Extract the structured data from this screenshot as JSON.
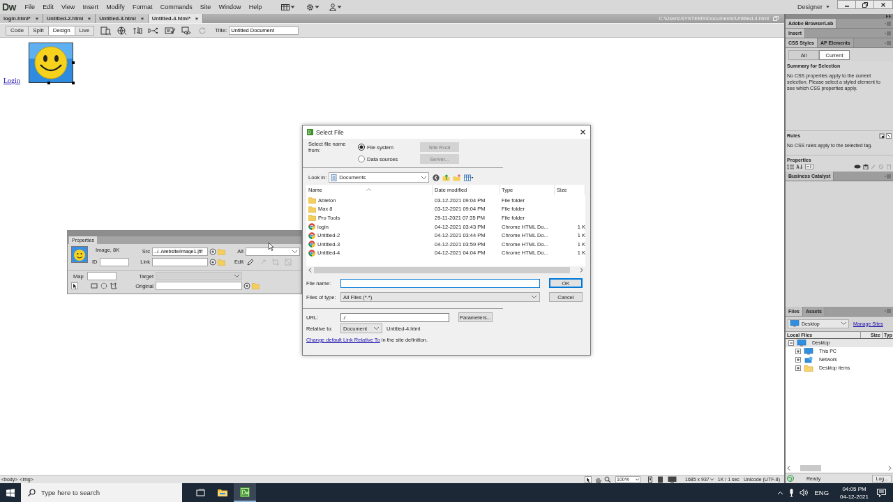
{
  "app": {
    "logo": "Dw",
    "menu": [
      "File",
      "Edit",
      "View",
      "Insert",
      "Modify",
      "Format",
      "Commands",
      "Site",
      "Window",
      "Help"
    ],
    "workspace": "Designer"
  },
  "doc_tabs": [
    {
      "label": "login.html*",
      "selected": false
    },
    {
      "label": "Untitled-2.html",
      "selected": false
    },
    {
      "label": "Untitled-3.html",
      "selected": false
    },
    {
      "label": "Untitled-4.html*",
      "selected": true
    }
  ],
  "file_path": "C:\\Users\\SYSTEMS\\Documents\\Untitled-4.html",
  "view_buttons": [
    {
      "label": "Code",
      "selected": false
    },
    {
      "label": "Split",
      "selected": false
    },
    {
      "label": "Design",
      "selected": true
    },
    {
      "label": "Live",
      "selected": false
    }
  ],
  "title_field": {
    "label": "Title:",
    "value": "Untitled Document"
  },
  "document": {
    "link": "Login"
  },
  "status_bar": {
    "tags": [
      "<body>",
      "<img>"
    ],
    "zoom": "100%",
    "dimensions": "1685 x 937",
    "download": "1K / 1 sec",
    "encoding": "Unicode (UTF-8)"
  },
  "properties": {
    "title": "Properties",
    "summary": "Image, 8K",
    "id_label": "ID",
    "src_label": "Src",
    "src": "../../website/image1.jfif",
    "alt_label": "Alt",
    "link_label": "Link",
    "edit_label": "Edit",
    "map_label": "Map",
    "target_label": "Target",
    "original_label": "Original"
  },
  "dialog": {
    "title": "Select File",
    "source_label": "Select file name from:",
    "sources": [
      {
        "label": "File system",
        "selected": true
      },
      {
        "label": "Data sources",
        "selected": false
      }
    ],
    "site_root": "Site Root",
    "server": "Server...",
    "look_in_label": "Look in:",
    "look_in": "Documents",
    "columns": [
      "Name",
      "Date modified",
      "Type",
      "Size"
    ],
    "files": [
      {
        "kind": "folder",
        "name": "Ableton",
        "date": "03-12-2021 09:04 PM",
        "type": "File folder"
      },
      {
        "kind": "folder",
        "name": "Max 8",
        "date": "03-12-2021 09:04 PM",
        "type": "File folder"
      },
      {
        "kind": "folder",
        "name": "Pro Tools",
        "date": "29-11-2021 07:35 PM",
        "type": "File folder"
      },
      {
        "kind": "html",
        "name": "login",
        "date": "04-12-2021 03:43 PM",
        "type": "Chrome HTML Do...",
        "size": "1 K"
      },
      {
        "kind": "html",
        "name": "Untitled-2",
        "date": "04-12-2021 03:44 PM",
        "type": "Chrome HTML Do...",
        "size": "1 K"
      },
      {
        "kind": "html",
        "name": "Untitled-3",
        "date": "04-12-2021 03:59 PM",
        "type": "Chrome HTML Do...",
        "size": "1 K"
      },
      {
        "kind": "html",
        "name": "Untitled-4",
        "date": "04-12-2021 04:04 PM",
        "type": "Chrome HTML Do...",
        "size": "1 K"
      }
    ],
    "file_name_label": "File name:",
    "ok": "OK",
    "files_of_type_label": "Files of type:",
    "files_of_type": "All Files (*.*)",
    "cancel": "Cancel",
    "url_label": "URL:",
    "url": "./",
    "parameters": "Parameters...",
    "relative_label": "Relative to:",
    "relative": "Document",
    "relative_file": "Untitled-4.html",
    "link": "Change default Link Relative To",
    "link_suffix": "in the site definition."
  },
  "side_panel": {
    "browserlab": "Adobe BrowserLab",
    "insert": "Insert",
    "css_tabs": [
      {
        "label": "CSS Styles",
        "selected": true
      },
      {
        "label": "AP Elements",
        "selected": false
      }
    ],
    "css_modes": [
      {
        "label": "All",
        "selected": false
      },
      {
        "label": "Current",
        "selected": true
      }
    ],
    "summary_title": "Summary for Selection",
    "summary_text": "No CSS properties apply to the current selection.  Please select a styled element to see which CSS properties apply.",
    "rules_title": "Rules",
    "rules_text": "No CSS rules apply to the selected tag.",
    "properties_title": "Properties",
    "business_catalyst": "Business Catalyst",
    "files_tabs": [
      {
        "label": "Files",
        "selected": true
      },
      {
        "label": "Assets",
        "selected": false
      }
    ],
    "site": "Desktop",
    "manage_sites": "Manage Sites",
    "columns": [
      "Local Files",
      "Size",
      "Typ"
    ],
    "tree": [
      {
        "label": "Desktop",
        "kind": "monitor",
        "expanded": true,
        "children": [
          {
            "label": "This PC",
            "kind": "monitor",
            "expanded": false
          },
          {
            "label": "Network",
            "kind": "network",
            "expanded": false
          },
          {
            "label": "Desktop items",
            "kind": "folder",
            "expanded": false
          }
        ]
      }
    ],
    "status": "Ready",
    "log": "Log..."
  },
  "taskbar": {
    "search_placeholder": "Type here to search",
    "language": "ENG",
    "time": "04:05 PM",
    "date": "04-12-2021"
  }
}
